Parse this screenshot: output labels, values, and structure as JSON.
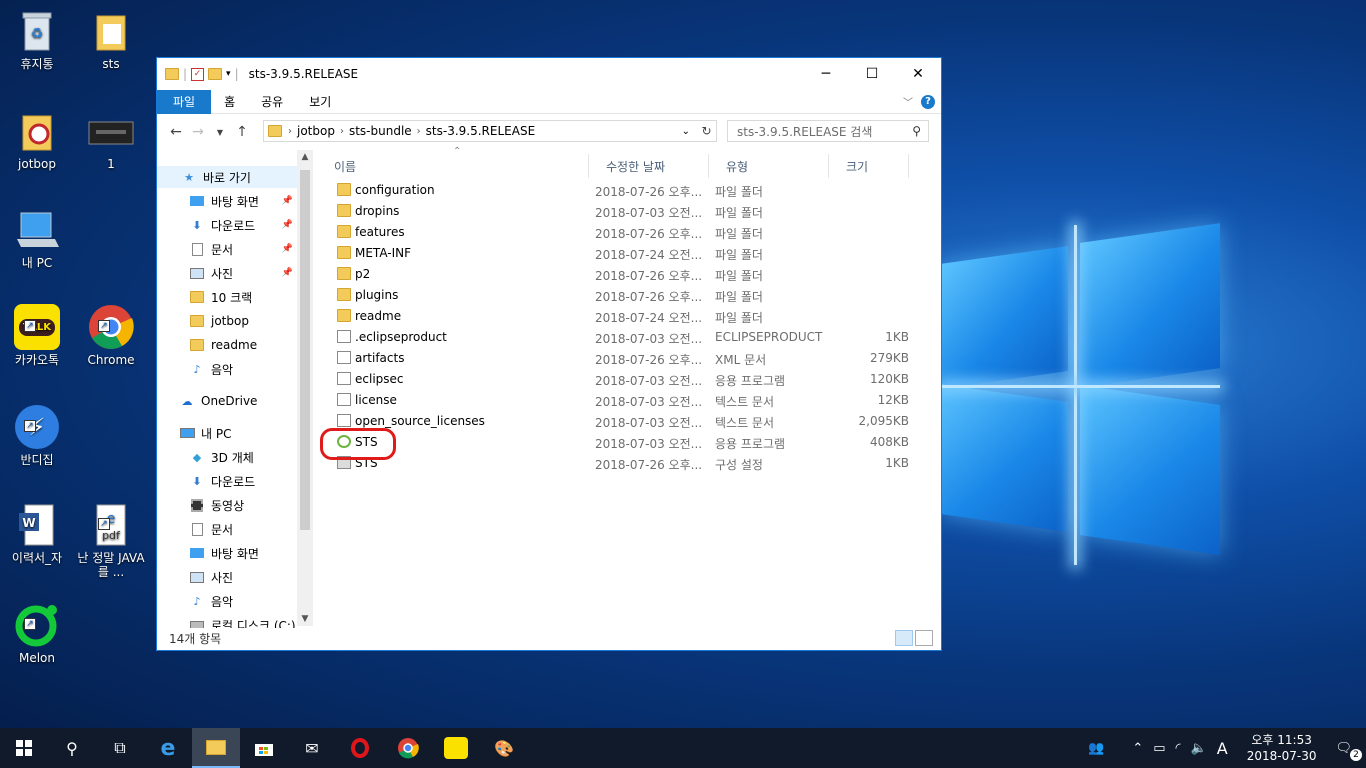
{
  "desktop": {
    "icons": [
      {
        "label": "휴지통",
        "icon": "recycle-bin-icon"
      },
      {
        "label": "sts",
        "icon": "folder-icon"
      },
      {
        "label": "jotbop",
        "icon": "folder-icon"
      },
      {
        "label": "1",
        "icon": "image-file-icon"
      },
      {
        "label": "내 PC",
        "icon": "computer-icon"
      },
      {
        "label": "카카오톡",
        "icon": "kakaotalk-icon"
      },
      {
        "label": "Chrome",
        "icon": "chrome-icon"
      },
      {
        "label": "반디집",
        "icon": "bandizip-icon"
      },
      {
        "label": "이력서_자",
        "icon": "word-doc-icon"
      },
      {
        "label": "난 정말 JAVA를 ...",
        "icon": "pdf-icon"
      },
      {
        "label": "Melon",
        "icon": "melon-icon"
      }
    ],
    "kakao_badge": "TALK",
    "pdf_badge": "pdf"
  },
  "window": {
    "title": "sts-3.9.5.RELEASE",
    "minimize": "─",
    "maximize": "☐",
    "close": "✕",
    "ribbon_tabs": [
      "파일",
      "홈",
      "공유",
      "보기"
    ],
    "help": "?",
    "breadcrumbs": [
      "jotbop",
      "sts-bundle",
      "sts-3.9.5.RELEASE"
    ],
    "search_placeholder": "sts-3.9.5.RELEASE 검색",
    "nav": [
      {
        "label": "바로 가기",
        "icon": "star-icon",
        "pinned": false,
        "selected": true
      },
      {
        "label": "바탕 화면",
        "icon": "desktop-icon",
        "pinned": true
      },
      {
        "label": "다운로드",
        "icon": "download-icon",
        "pinned": true
      },
      {
        "label": "문서",
        "icon": "document-icon",
        "pinned": true
      },
      {
        "label": "사진",
        "icon": "picture-icon",
        "pinned": true
      },
      {
        "label": "10 크랙",
        "icon": "folder-icon",
        "pinned": false
      },
      {
        "label": "jotbop",
        "icon": "folder-icon",
        "pinned": false
      },
      {
        "label": "readme",
        "icon": "folder-icon",
        "pinned": false
      },
      {
        "label": "음악",
        "icon": "music-icon",
        "pinned": false
      },
      {
        "label": "OneDrive",
        "icon": "cloud-icon",
        "pinned": false
      },
      {
        "label": "내 PC",
        "icon": "computer-icon",
        "pinned": false
      },
      {
        "label": "3D 개체",
        "icon": "cube-icon",
        "pinned": false
      },
      {
        "label": "다운로드",
        "icon": "download-icon",
        "pinned": false
      },
      {
        "label": "동영상",
        "icon": "video-icon",
        "pinned": false
      },
      {
        "label": "문서",
        "icon": "document-icon",
        "pinned": false
      },
      {
        "label": "바탕 화면",
        "icon": "desktop-icon",
        "pinned": false
      },
      {
        "label": "사진",
        "icon": "picture-icon",
        "pinned": false
      },
      {
        "label": "음악",
        "icon": "music-icon",
        "pinned": false
      },
      {
        "label": "로컬 디스크 (C:)",
        "icon": "disk-icon",
        "pinned": false
      }
    ],
    "columns": [
      "이름",
      "수정한 날짜",
      "유형",
      "크기"
    ],
    "files": [
      {
        "name": "configuration",
        "date": "2018-07-26 오후...",
        "type": "파일 폴더",
        "size": "",
        "kind": "folder"
      },
      {
        "name": "dropins",
        "date": "2018-07-03 오전...",
        "type": "파일 폴더",
        "size": "",
        "kind": "folder"
      },
      {
        "name": "features",
        "date": "2018-07-26 오후...",
        "type": "파일 폴더",
        "size": "",
        "kind": "folder"
      },
      {
        "name": "META-INF",
        "date": "2018-07-24 오전...",
        "type": "파일 폴더",
        "size": "",
        "kind": "folder"
      },
      {
        "name": "p2",
        "date": "2018-07-26 오후...",
        "type": "파일 폴더",
        "size": "",
        "kind": "folder"
      },
      {
        "name": "plugins",
        "date": "2018-07-26 오후...",
        "type": "파일 폴더",
        "size": "",
        "kind": "folder"
      },
      {
        "name": "readme",
        "date": "2018-07-24 오전...",
        "type": "파일 폴더",
        "size": "",
        "kind": "folder"
      },
      {
        "name": ".eclipseproduct",
        "date": "2018-07-03 오전...",
        "type": "ECLIPSEPRODUCT",
        "size": "1KB",
        "kind": "doc"
      },
      {
        "name": "artifacts",
        "date": "2018-07-26 오후...",
        "type": "XML 문서",
        "size": "279KB",
        "kind": "doc"
      },
      {
        "name": "eclipsec",
        "date": "2018-07-03 오전...",
        "type": "응용 프로그램",
        "size": "120KB",
        "kind": "doc"
      },
      {
        "name": "license",
        "date": "2018-07-03 오전...",
        "type": "텍스트 문서",
        "size": "12KB",
        "kind": "doc"
      },
      {
        "name": "open_source_licenses",
        "date": "2018-07-03 오전...",
        "type": "텍스트 문서",
        "size": "2,095KB",
        "kind": "doc"
      },
      {
        "name": "STS",
        "date": "2018-07-03 오전...",
        "type": "응용 프로그램",
        "size": "408KB",
        "kind": "sts"
      },
      {
        "name": "STS",
        "date": "2018-07-26 오후...",
        "type": "구성 설정",
        "size": "1KB",
        "kind": "cfg"
      }
    ],
    "status": "14개 항목"
  },
  "taskbar": {
    "apps": [
      "start-icon",
      "search-icon",
      "task-view-icon",
      "edge-icon",
      "file-explorer-icon",
      "store-icon",
      "mail-icon",
      "opera-icon",
      "chrome-icon",
      "kakaotalk-icon",
      "paint-icon"
    ],
    "ime": "A",
    "time": "오후 11:53",
    "date": "2018-07-30",
    "notifications": "2"
  }
}
